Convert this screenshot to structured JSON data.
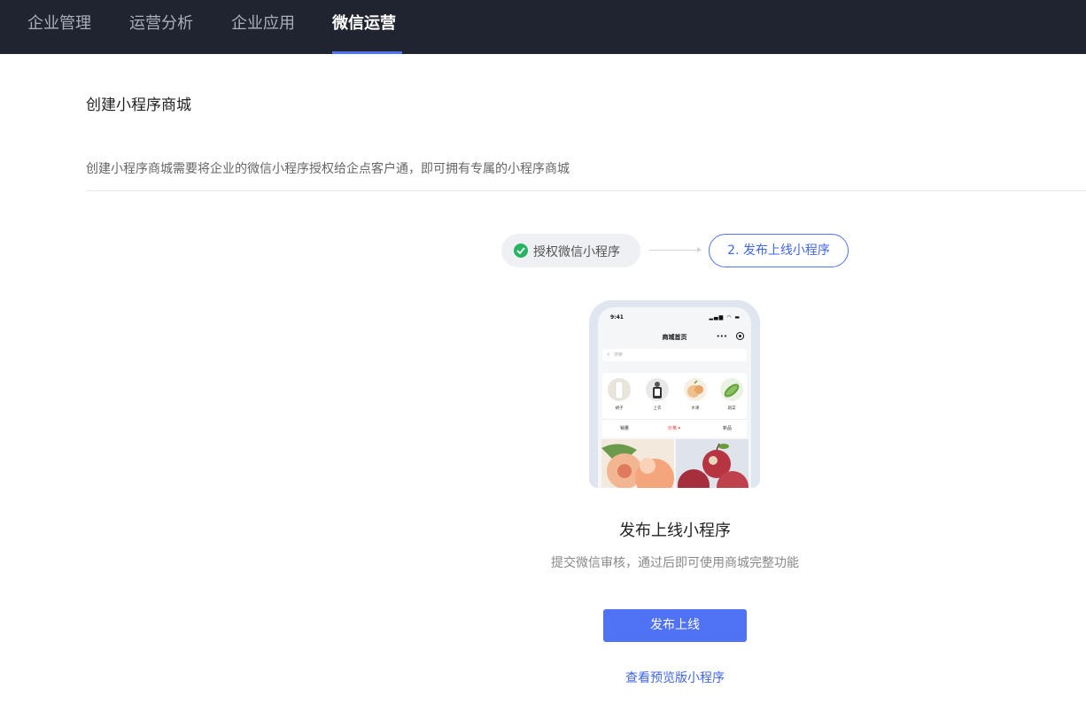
{
  "topnav": {
    "tabs": [
      {
        "label": "企业管理",
        "active": false
      },
      {
        "label": "运营分析",
        "active": false
      },
      {
        "label": "企业应用",
        "active": false
      },
      {
        "label": "微信运营",
        "active": true
      }
    ]
  },
  "page": {
    "title": "创建小程序商城",
    "description": "创建小程序商城需要将企业的微信小程序授权给企点客户通，即可拥有专属的小程序商城"
  },
  "steps": {
    "step1": {
      "label": "授权微信小程序",
      "status": "completed"
    },
    "step2": {
      "label": "2. 发布上线小程序",
      "status": "current"
    }
  },
  "phone_preview": {
    "status_time": "9:41",
    "status_icons": "▂▄▆ ◠ ▬",
    "page_title": "商城首页",
    "menu_dots": "•••",
    "search_placeholder": "搜索",
    "categories": [
      {
        "label": "裙子",
        "color": "#e9e4dc"
      },
      {
        "label": "上衣",
        "color": "#dcdcdc"
      },
      {
        "label": "水果",
        "color": "#f0d3b0"
      },
      {
        "label": "蔬菜",
        "color": "#cfe4c2"
      }
    ],
    "sort_tabs": [
      "销量",
      "价格 ▾",
      "新品"
    ]
  },
  "main": {
    "title": "发布上线小程序",
    "subtitle": "提交微信审核，通过后即可使用商城完整功能",
    "publish_button": "发布上线",
    "preview_link": "查看预览版小程序"
  },
  "colors": {
    "nav_bg": "#1f2430",
    "accent": "#4f73f4",
    "success": "#28b463"
  }
}
